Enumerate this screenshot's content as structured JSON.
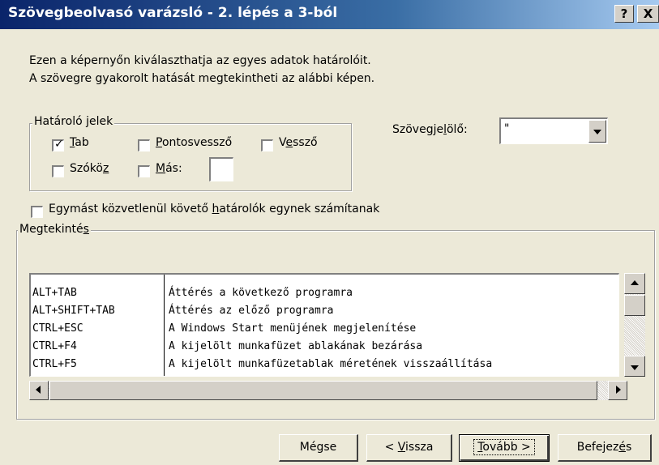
{
  "window": {
    "title": "Szövegbeolvasó varázsló - 2. lépés a 3-ból",
    "help_label": "?",
    "close_label": "X"
  },
  "intro": {
    "line1": "Ezen a képernyőn kiválaszthatja az egyes adatok határolóit.",
    "line2": "A szövegre gyakorolt hatását megtekintheti az alábbi képen."
  },
  "delimiters": {
    "legend": "Határoló jelek",
    "tab": {
      "pre": "",
      "u": "T",
      "post": "ab",
      "checked": true
    },
    "semicolon": {
      "pre": "",
      "u": "P",
      "post": "ontosvessző",
      "checked": false
    },
    "comma": {
      "pre": "V",
      "u": "e",
      "post": "ssző",
      "checked": false
    },
    "space": {
      "pre": "Szókö",
      "u": "z",
      "post": "",
      "checked": false
    },
    "other": {
      "pre": "",
      "u": "M",
      "post": "ás:",
      "checked": false
    },
    "other_value": ""
  },
  "qualifier": {
    "label_pre": "Szövegje",
    "label_u": "l",
    "label_post": "ölő:",
    "value": "\""
  },
  "consecutive": {
    "pre": "Egymást közvetlenül követő ",
    "u": "h",
    "post": "atárolók egynek számítanak",
    "checked": false
  },
  "preview": {
    "legend_pre": "Megtekinté",
    "legend_u": "s",
    "rows": [
      {
        "key": "ALT+TAB",
        "desc": "Áttérés a következő programra"
      },
      {
        "key": "ALT+SHIFT+TAB",
        "desc": "Áttérés az előző programra"
      },
      {
        "key": "CTRL+ESC",
        "desc": "A Windows Start menüjének megjelenítése"
      },
      {
        "key": "CTRL+F4",
        "desc": "A kijelölt munkafüzet ablakának bezárása"
      },
      {
        "key": "CTRL+F5",
        "desc": "A kijelölt munkafüzetablak méretének visszaállítása"
      }
    ]
  },
  "buttons": {
    "cancel": "Mégse",
    "back_pre": "< ",
    "back_u": "V",
    "back_post": "issza",
    "next_pre": "",
    "next_u": "T",
    "next_post": "ovább >",
    "finish_pre": "Befejez",
    "finish_u": "é",
    "finish_post": "s"
  }
}
